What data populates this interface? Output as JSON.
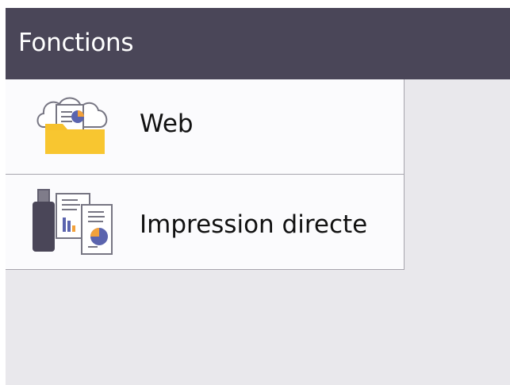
{
  "header": {
    "title": "Fonctions"
  },
  "menu": {
    "items": [
      {
        "label": "Web",
        "icon": "cloud-folder-icon"
      },
      {
        "label": "Impression directe",
        "icon": "usb-documents-icon"
      }
    ]
  },
  "colors": {
    "header_background": "#4a4658",
    "header_text": "#ffffff",
    "panel_background": "#e9e8ec",
    "menu_background": "#fbfbfd",
    "divider": "#a7a5ad",
    "folder": "#f6c12c",
    "chart_blue": "#5b64ae",
    "chart_orange": "#f2a13b"
  }
}
